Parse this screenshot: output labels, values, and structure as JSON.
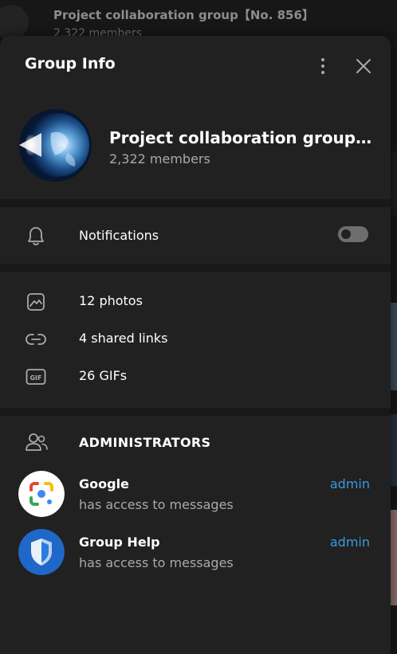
{
  "background": {
    "chat_title": "Project collaboration group【No. 856】",
    "chat_subtitle": "2,322 members"
  },
  "panel": {
    "title": "Group Info",
    "menu_icon": "more-vertical-icon",
    "close_icon": "close-icon"
  },
  "group": {
    "name": "Project collaboration group【No. 856】",
    "members": "2,322 members"
  },
  "notifications": {
    "label": "Notifications",
    "enabled": false
  },
  "media": [
    {
      "icon": "photo-icon",
      "label": "12 photos"
    },
    {
      "icon": "link-icon",
      "label": "4 shared links"
    },
    {
      "icon": "gif-icon",
      "label": "26 GIFs"
    }
  ],
  "administrators": {
    "heading": "ADMINISTRATORS",
    "items": [
      {
        "name": "Google",
        "description": "has access to messages",
        "role": "admin"
      },
      {
        "name": "Group Help",
        "description": "has access to messages",
        "role": "admin"
      }
    ]
  },
  "colors": {
    "accent": "#3a9bdc",
    "panel": "#212121",
    "divider": "#181818"
  }
}
